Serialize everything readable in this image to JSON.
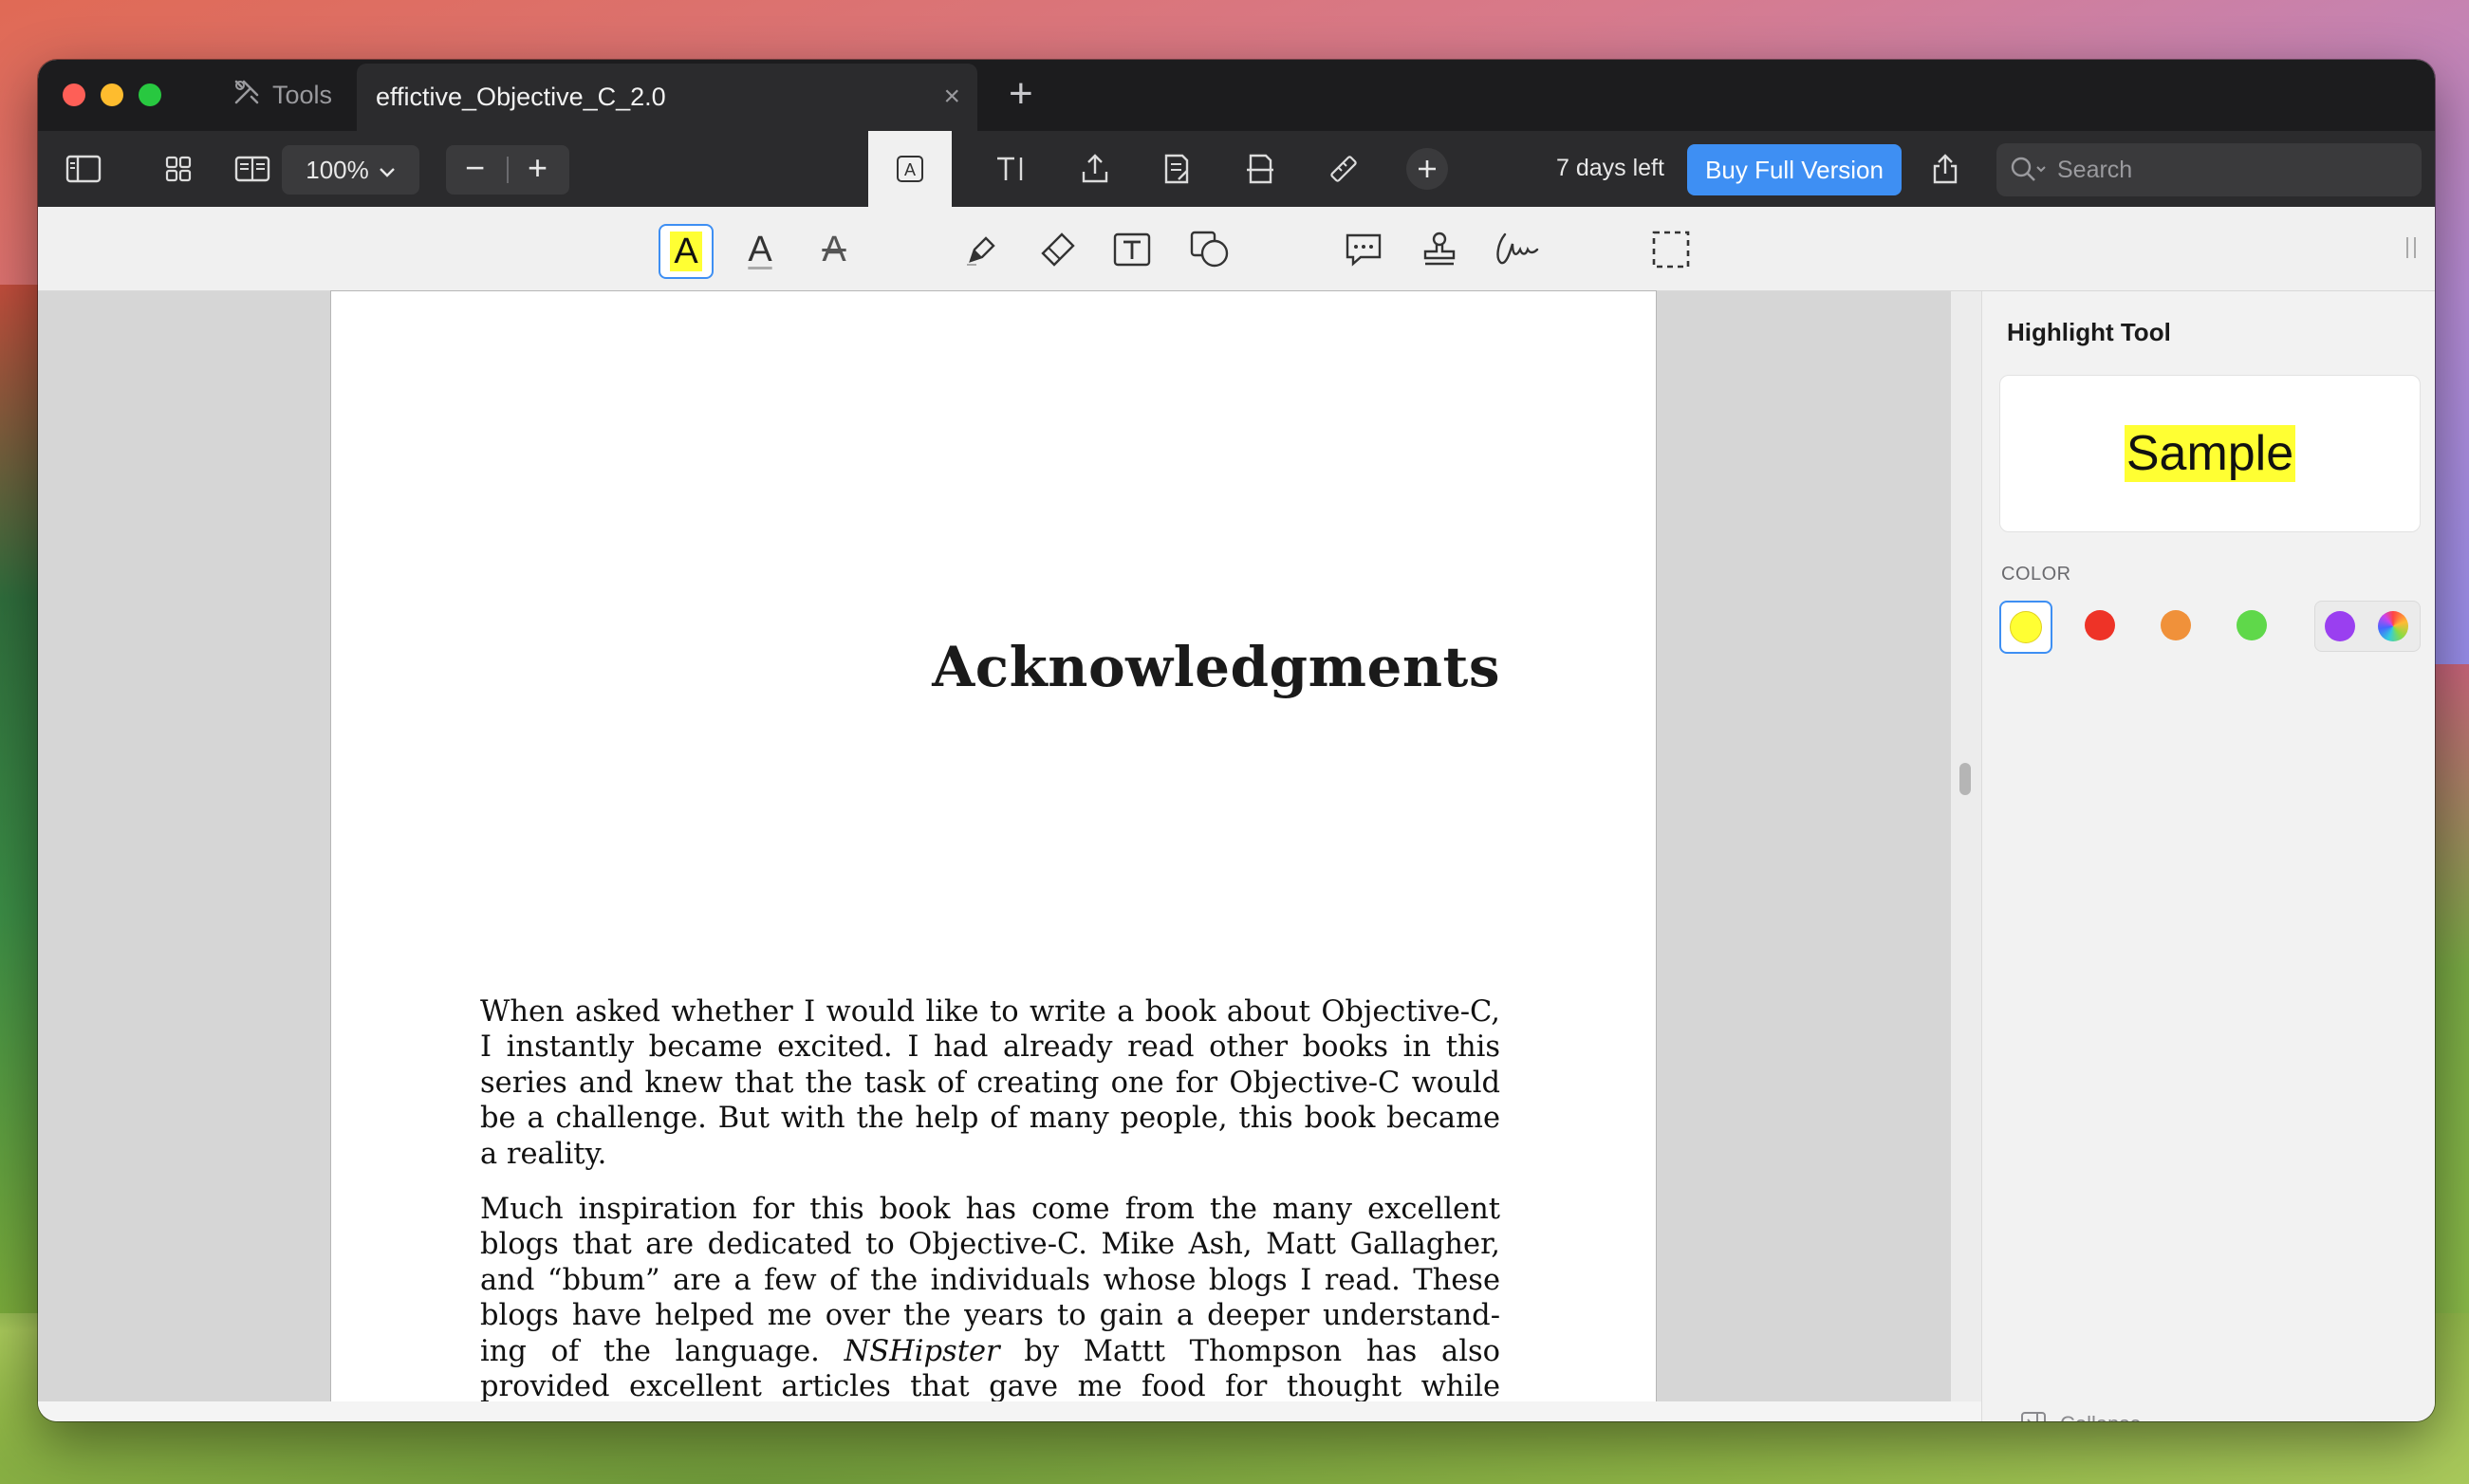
{
  "titlebar": {
    "tools_label": "Tools",
    "tab_title": "effictive_Objective_C_2.0",
    "close_glyph": "×",
    "add_tab_glyph": "+"
  },
  "toolbar": {
    "zoom_level": "100%",
    "zoom_out": "−",
    "zoom_in": "+",
    "days_left": "7 days left",
    "buy_label": "Buy Full Version",
    "search_placeholder": "Search"
  },
  "annotation_tools": {
    "highlight_glyph": "A",
    "underline_glyph": "A",
    "strike_glyph": "A"
  },
  "document": {
    "title": "Acknowledgments",
    "paragraph1": "When asked whether I would like to write a book about Objective-C, I instantly became excited. I had already read other books in this series and knew that the task of creating one for Objective-C would be a challenge. But with the help of many people, this book became a reality.",
    "paragraph2_a": "Much inspiration for this book has come from the many excellent blogs that are dedicated to Objective-C. Mike Ash, Matt Gallagher, and “bbum” are a few of the individuals whose blogs I read. These blogs have helped me over the years to gain a deeper understand-ing of the language. ",
    "paragraph2_italic": "NSHipster",
    "paragraph2_b": " by Mattt Thompson has also provided excellent articles that gave me food for thought while compiling this book. Finally, the excellent documentation provided by Apple has also been extremely useful."
  },
  "inspector": {
    "title": "Highlight Tool",
    "sample": "Sample",
    "color_label": "COLOR",
    "collapse_label": "Collapse",
    "colors": [
      "#ffff33",
      "#ee3327",
      "#f0913a",
      "#5fd84a",
      "#9a3ff0"
    ]
  }
}
